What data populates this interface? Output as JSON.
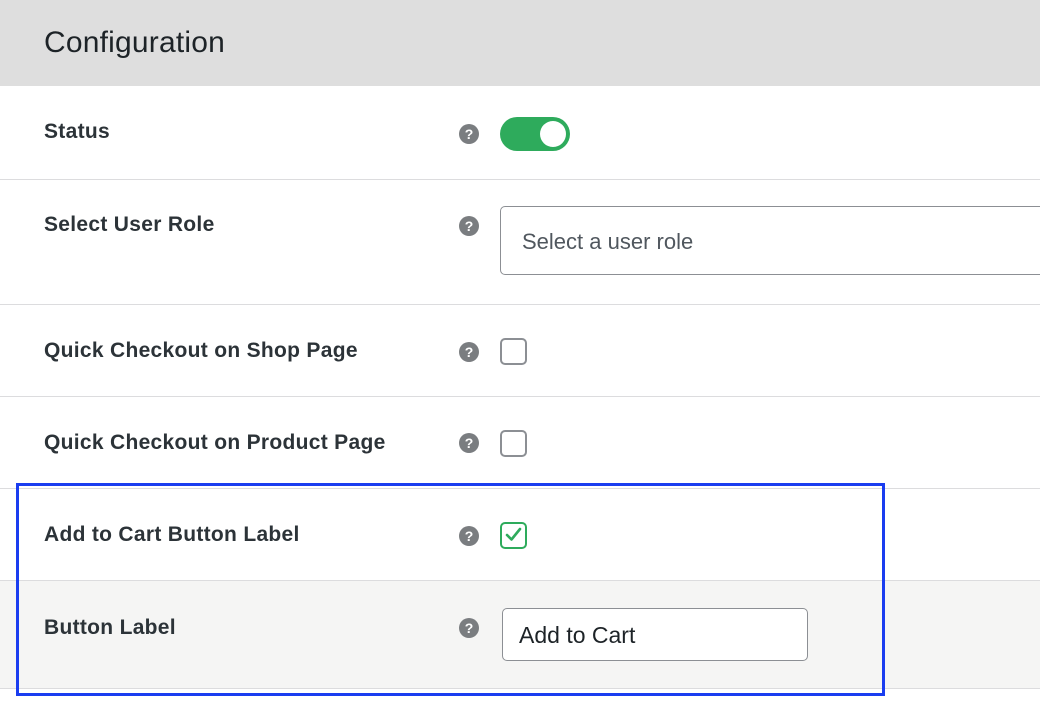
{
  "header": {
    "title": "Configuration"
  },
  "rows": [
    {
      "label": "Status",
      "control": "toggle",
      "toggle_on": true,
      "help_glyph": "?"
    },
    {
      "label": "Select User Role",
      "control": "select",
      "placeholder": "Select a user role",
      "help_glyph": "?"
    },
    {
      "label": "Quick Checkout on Shop Page",
      "control": "checkbox",
      "checked": false,
      "help_glyph": "?"
    },
    {
      "label": "Quick Checkout on Product Page",
      "control": "checkbox",
      "checked": false,
      "help_glyph": "?"
    },
    {
      "label": "Add to Cart Button Label",
      "control": "checkbox",
      "checked": true,
      "help_glyph": "?"
    },
    {
      "label": "Button Label",
      "control": "text",
      "value": "Add to Cart",
      "help_glyph": "?"
    }
  ],
  "colors": {
    "toggle_on": "#2eab5c",
    "checkbox_checked": "#2eab5c",
    "highlight_border": "#1a3df0",
    "header_bg": "#dedede",
    "help_icon_bg": "#7a7d80"
  },
  "icons": {
    "help": "question-circle-icon",
    "check": "checkmark-icon"
  }
}
